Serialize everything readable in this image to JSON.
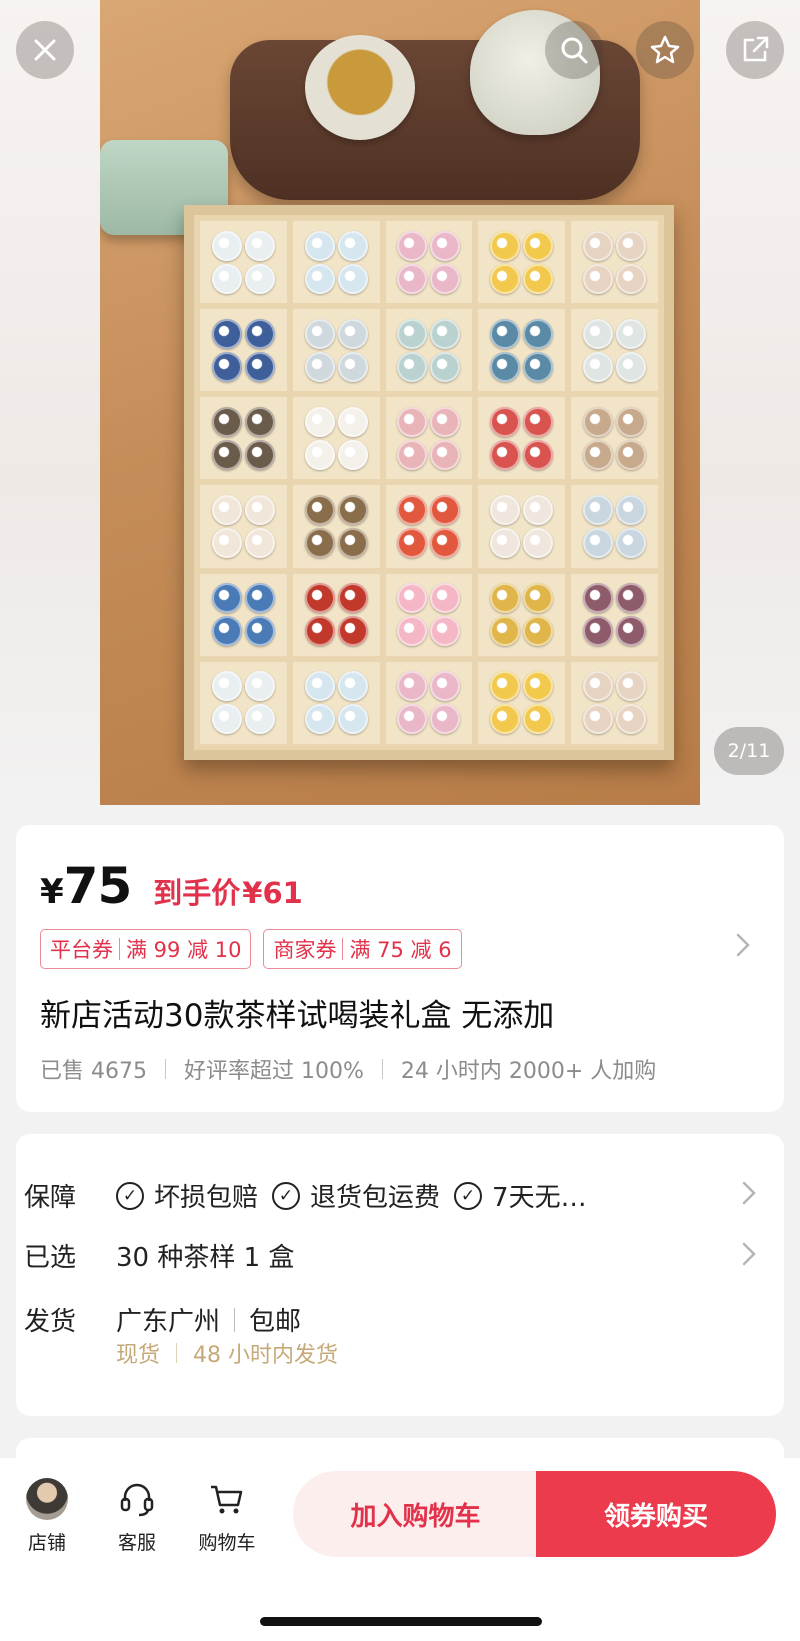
{
  "gallery": {
    "page_indicator": "2/11"
  },
  "top_actions": {
    "close_icon": "close-icon",
    "search_icon": "search-icon",
    "favorite_icon": "star-icon",
    "share_icon": "share-icon"
  },
  "price": {
    "currency": "¥",
    "value": "75",
    "deal_label": "到手价",
    "deal_price": "¥61"
  },
  "coupons": [
    {
      "type": "平台券",
      "rule": "满 99 减 10"
    },
    {
      "type": "商家券",
      "rule": "满 75 减 6"
    }
  ],
  "product": {
    "title": "新店活动30款茶样试喝装礼盒 无添加",
    "sold": "已售 4675",
    "rating": "好评率超过 100%",
    "trend": "24 小时内 2000+ 人加购"
  },
  "details": {
    "guarantee_label": "保障",
    "guarantees": [
      "坏损包赔",
      "退货包运费",
      "7天无…"
    ],
    "selected_label": "已选",
    "selected_value": "30 种茶样 1 盒",
    "shipping_label": "发货",
    "shipping_origin": "广东广州",
    "shipping_fee": "包邮",
    "stock_status": "现货",
    "dispatch_time": "48 小时内发货"
  },
  "bottom_bar": {
    "store_label": "店铺",
    "service_label": "客服",
    "cart_label": "购物车",
    "add_to_cart": "加入购物车",
    "buy_now": "领券购买"
  },
  "colors": {
    "accent": "#e2314a",
    "buy_button": "#ec3b4d",
    "cart_button_bg": "#fdeeee",
    "shipping_sub": "#c6a978"
  }
}
